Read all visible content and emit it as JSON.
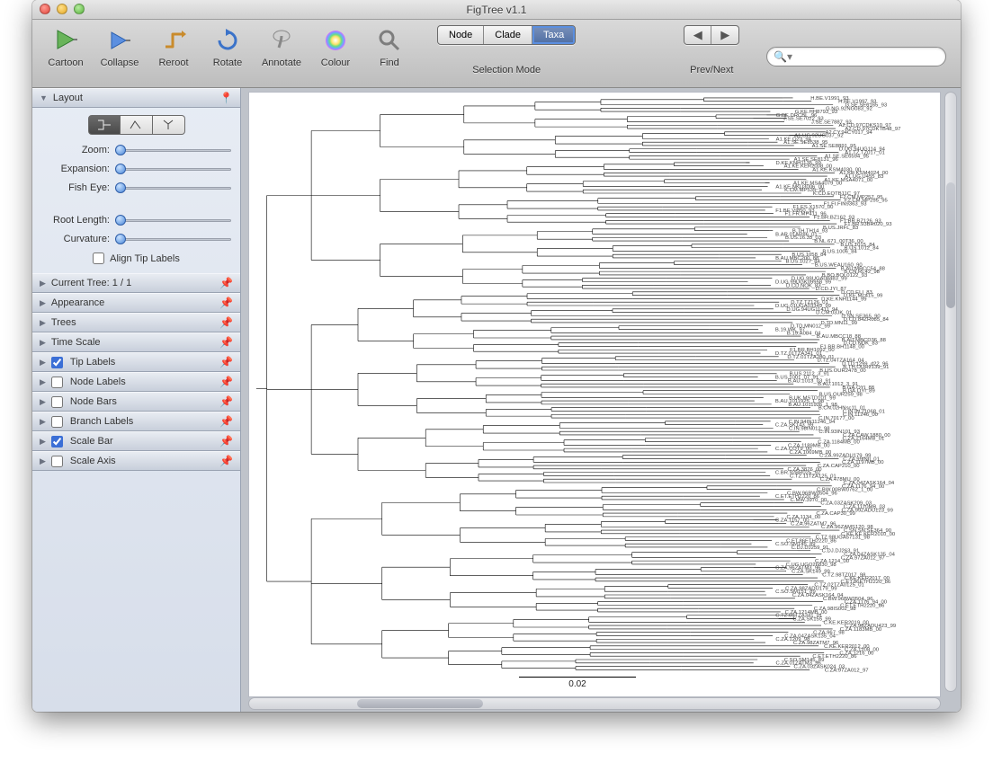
{
  "window": {
    "title": "FigTree v1.1"
  },
  "toolbar": {
    "items": [
      {
        "label": "Cartoon"
      },
      {
        "label": "Collapse"
      },
      {
        "label": "Reroot"
      },
      {
        "label": "Rotate"
      },
      {
        "label": "Annotate"
      },
      {
        "label": "Colour"
      },
      {
        "label": "Find"
      }
    ],
    "selection_mode_label": "Selection Mode",
    "selection_modes": {
      "node": "Node",
      "clade": "Clade",
      "taxa": "Taxa",
      "active": "taxa"
    },
    "prevnext_label": "Prev/Next",
    "search_placeholder": ""
  },
  "sidebar": {
    "layout": {
      "title": "Layout",
      "zoom": "Zoom:",
      "expansion": "Expansion:",
      "fisheye": "Fish Eye:",
      "root_length": "Root Length:",
      "curvature": "Curvature:",
      "align_tip_labels": "Align Tip Labels"
    },
    "panels": [
      {
        "title": "Current Tree: 1 / 1",
        "check": null
      },
      {
        "title": "Appearance",
        "check": null
      },
      {
        "title": "Trees",
        "check": null
      },
      {
        "title": "Time Scale",
        "check": null
      },
      {
        "title": "Tip Labels",
        "check": true
      },
      {
        "title": "Node Labels",
        "check": false
      },
      {
        "title": "Node Bars",
        "check": false
      },
      {
        "title": "Branch Labels",
        "check": false
      },
      {
        "title": "Scale Bar",
        "check": true
      },
      {
        "title": "Scale Axis",
        "check": false
      }
    ]
  },
  "tree": {
    "scale_bar_value": "0.02",
    "tip_labels": [
      "H.BE.V1991_93",
      "H.BE.V1997_93",
      "G.SE.SE6165_93",
      "G.NG.92NG083_92",
      "G.KE.HH8793_93",
      "G.BE.DRCBL_96",
      "J.SE.SE7022_93",
      "J.SE.SE7887_93",
      "A2.CD.97CDKS10_97",
      "A2.CD.97CDKTB48_97",
      "A2.CY.94CY017_94",
      "A1.UG.92UG037_92",
      "A1.KE.Q23_94",
      "A1.SE.SE8538_95",
      "A1.SE.SE8891_95",
      "D.UG.94UG114_94",
      "A1.TZ.TZ017_01",
      "A1.SE.SE6594_95",
      "A1.SE.SE8131_96",
      "D.KE.KNH1135_99",
      "A1.KE.KER2008_00",
      "A1.KE.KSM4030_00",
      "A1.KE.KSM4024_00",
      "A1.UG.U455_83",
      "A1.KE.MSA4071_00",
      "A1.KE.MSA4079_00",
      "A1.KE.NKU3006_00",
      "K.CM.MP535_96",
      "K.CD.EQTB11C_97",
      "F2.CM.MP257_95",
      "F2.CM.MP255_95",
      "F1.FI.FIN9363_93",
      "F1.ES.X1570_00",
      "F1.BE.VI850_93",
      "F1.FR.MP411_96",
      "F1.BR.BZ162_93",
      "F1.BR.BZ126_93",
      "F1.BR.93BR020_93",
      "B.US.JRFL_83",
      "B.TH.TH14_93",
      "B.AR.01AR86_01",
      "B.US.16.33_03",
      "B.NL.671_00T36_00",
      "B.US.1015_84",
      "B.US.1012_84",
      "B.US.1006_84",
      "B.US.1058_84",
      "B.AU.MBC200_88",
      "B.US.1027_84",
      "B.US.WEAU160_90",
      "B.AU.MBCC54_88",
      "B.CN.RL42_98",
      "B.BO.BOL0122_93",
      "D.UG.99UGA08483_99",
      "D.UG.99UGK09958_99",
      "D.CD.NOK_83",
      "D.CD.JYI_87",
      "D.CD.ELI_83",
      "D.KE.ML415_99",
      "D.KE.KNH1144_99",
      "D.TZ.TZ126_01",
      "D.UG.01UGA03349_99",
      "D.UG.94UG11411_94",
      "D.CM.03JK_01",
      "D.SN.SE365_90",
      "D.CD.84ZR085_84",
      "D.TD.MN11_99",
      "D.TD.MN012_99",
      "B.19.WK_97",
      "B.19.A084_04",
      "B.AU.MBCC18_88",
      "B.AU.MBCD36_88",
      "D.CD.NDK_83",
      "F1.BR.BH1148_00",
      "F1.BR.BH1092_00",
      "D.TZ.01TZA341_01",
      "D.TZ.01TZA280_01",
      "D.TZ.04TZA164_04",
      "D.TD.1299_d22_96",
      "B.TH.OUR2139_91",
      "B.US.OUR2478_00",
      "B.US.2112_3_91",
      "B.US.1001_07_91",
      "B.AU.1013_03_91",
      "B.AU.1012_3_91",
      "B.GA.OYI_88",
      "B.GA.OYI_89",
      "B.US.OUR259_98",
      "B.UK.MSTD101_99",
      "B.AU.1011925_1_98",
      "B.AU.1011926_1_98",
      "B.CN.02HNsc11_01",
      "C.IN.IN.21068_01",
      "C.IN.11246_00",
      "C.IN.70177_00",
      "C.IN.94IN11246_94",
      "C.ZA.SK143_99",
      "C.IN.98IN012_98",
      "C.IN.93IN101_93",
      "C.ZA.CAW.1880_00",
      "C.ZA.2164MB_01",
      "C.ZA.1184MB_00",
      "C.ZA.1189MB_00",
      "C.ZA.COT9_00",
      "C.ZA.1069MB_00",
      "C.ZA.99ZADU179_99",
      "C.ZA.99INII_01",
      "C.ZA.1197MB_00",
      "C.ZA.CAP210_00",
      "C.ZA.3876_00",
      "C.BR.92BR025_92",
      "C.TZ.11TZA125_01",
      "C.ZA.478MU_00",
      "C.ZA.04ZASK164_04",
      "C.ZA.1176_94_00",
      "C.BW.00BW0762_1_00",
      "C.BW.96BW0504_96",
      "C.ET.ETH2220_86",
      "C.MW.3970_00",
      "C.ZA.03ZASK209_03",
      "C.ZA.1170MB_03",
      "C.ZA.99ZADU123_99",
      "C.ZA.CAP30_99",
      "C.ZA.1134_00",
      "C.ZA.1157_00",
      "C.ZA.96ZATM7_96",
      "C.ZA.96ZAMS120_98",
      "C.SN.SN.SE364_90",
      "C.KE.KE.KER2010_00",
      "C.TZ.98UGA57131_98",
      "C.ET.86ETH2220_86",
      "C.SO.SM145_89",
      "C.DJ.DJ259_91",
      "C.DJ.DJ263_91",
      "C.ZA.04ZASK135_04",
      "C.ZA.97ZA012_97",
      "C.ZA.1214_00",
      "C.UG.UGO26830_98",
      "C.ZA.96ZATM3_96",
      "C.ZA.SK149_99",
      "C.TZ.98TZ017_98",
      "C.KE.KER2017_00",
      "C.ET.86ETH2220_86",
      "C.TZ.02TZA0125_01",
      "C.ZA.98ZADU179_99",
      "C.SO.SM151_89",
      "C.ZA.04ZASK164_04",
      "C.BW.96BW0504_96",
      "C.ZA.1176_94_00",
      "C.ET.ETH2220_86",
      "C.ZA.98IS002_98",
      "C.ZA.1214MB_00",
      "C.TZ.01TZA341_01",
      "C.ZA.SK155_99",
      "C.KE.KER2019_00",
      "C.ZA.98ZADU423_99",
      "C.ZA.1183MB_00",
      "C.ZA.967_98",
      "C.ZA.04ZASK135_04",
      "C.ZA.1209_98",
      "C.ZA.98ZATM7_96",
      "C.KE.KER2012_00",
      "C.ZA.1208_00",
      "C.ZA.1216_00",
      "C.ET.ETH2220_86",
      "C.SO.SM145_89",
      "C.ZA.01ZATM3_96",
      "C.ZA.03ZASK024_03",
      "C.ZA.97ZA012_97"
    ]
  }
}
